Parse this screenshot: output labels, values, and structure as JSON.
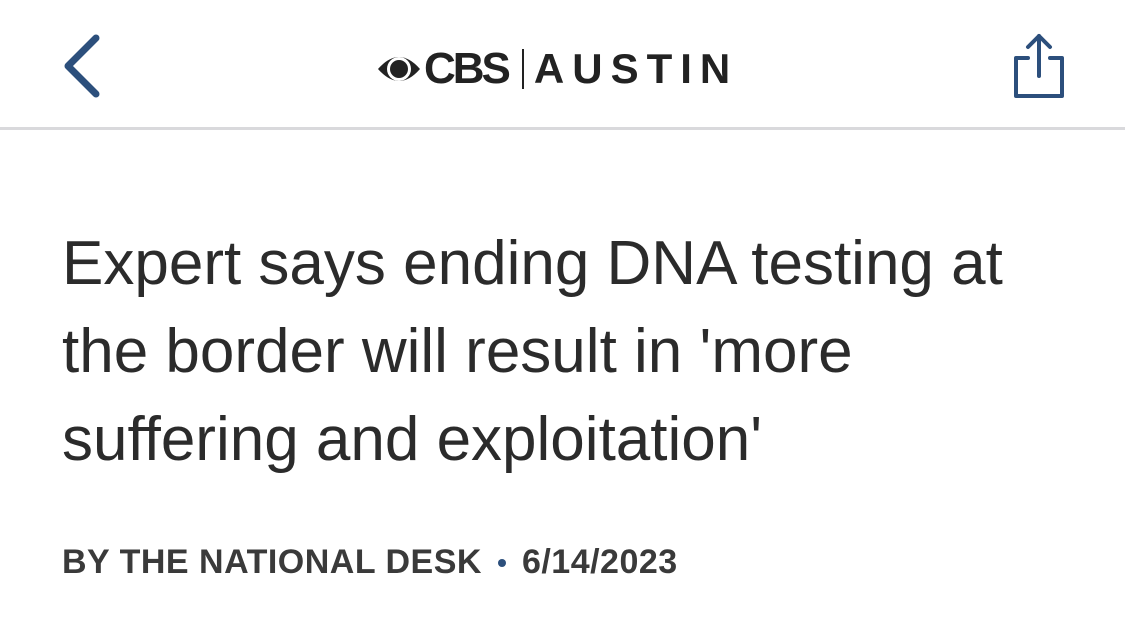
{
  "header": {
    "logo": {
      "network": "CBS",
      "station": "AUSTIN"
    },
    "icons": {
      "back": "chevron-left-icon",
      "share": "share-icon"
    },
    "accent_color": "#2c4f7c"
  },
  "article": {
    "headline": "Expert says ending DNA testing at the border will result in 'more suffering and exploitation'",
    "author": "BY THE NATIONAL DESK",
    "date": "6/14/2023"
  }
}
